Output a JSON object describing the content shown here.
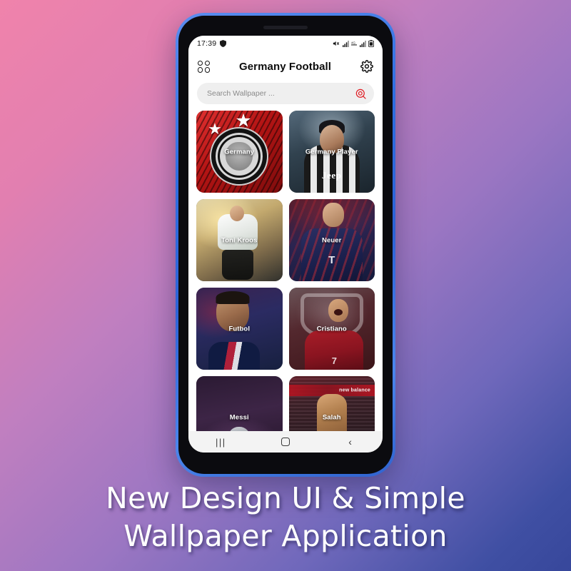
{
  "background": {
    "gradient_from": "#f083ab",
    "gradient_to": "#37479b"
  },
  "phone": {
    "bezel_color": "#2f6fe0",
    "frame_color": "#0b0b0f"
  },
  "statusbar": {
    "time": "17:39",
    "icons": [
      "shield-icon",
      "mute-icon",
      "signal-icon",
      "network-icon",
      "signal2-icon",
      "battery-icon"
    ]
  },
  "appbar": {
    "grid_icon": "grid-icon",
    "title": "Germany Football",
    "settings_icon": "gear-icon"
  },
  "search": {
    "placeholder": "Search Wallpaper ...",
    "value": "",
    "icon": "search-icon",
    "icon_color": "#e01f26"
  },
  "wallpapers": [
    {
      "label": "Germany",
      "art": "art-germany"
    },
    {
      "label": "Germany Player",
      "art": "art-gplayer"
    },
    {
      "label": "Toni Kroos",
      "art": "art-kroos"
    },
    {
      "label": "Neuer",
      "art": "art-neuer"
    },
    {
      "label": "Futbol",
      "art": "art-futbol"
    },
    {
      "label": "Cristiano",
      "art": "art-cristiano"
    },
    {
      "label": "Messi",
      "art": "art-messi"
    },
    {
      "label": "Salah",
      "art": "art-salah"
    }
  ],
  "artwork_text": {
    "juventus_sponsor": "Jeep",
    "bayern_sponsor": "T",
    "ronaldo_number": "7",
    "salah_banner": "new balance"
  },
  "navbar": {
    "recents": "|||",
    "home": "home-square",
    "back": "‹"
  },
  "caption": {
    "line1": "New Design UI & Simple",
    "line2": "Wallpaper Application"
  }
}
